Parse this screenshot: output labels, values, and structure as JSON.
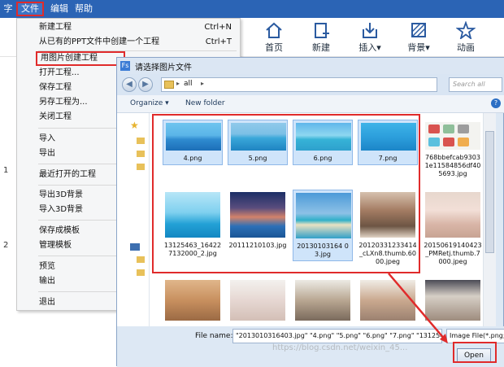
{
  "menubar": {
    "app_icon": "字",
    "items": [
      "文件",
      "编辑",
      "帮助"
    ]
  },
  "ribbon": {
    "buttons": [
      {
        "label": "首页",
        "icon": "home-icon"
      },
      {
        "label": "新建",
        "icon": "new-file-icon"
      },
      {
        "label": "插入▾",
        "icon": "insert-icon"
      },
      {
        "label": "背景▾",
        "icon": "background-icon"
      },
      {
        "label": "动画",
        "icon": "animation-star-icon"
      }
    ]
  },
  "left_numbers": [
    "1",
    "2"
  ],
  "file_menu": {
    "items": [
      {
        "label": "新建工程",
        "shortcut": "Ctrl+N"
      },
      {
        "label": "从已有的PPT文件中创建一个工程",
        "shortcut": "Ctrl+T"
      },
      {
        "label": "用图片创建工程",
        "shortcut": "",
        "highlighted": true
      },
      {
        "label": "打开工程...",
        "shortcut": ""
      },
      {
        "label": "保存工程",
        "shortcut": ""
      },
      {
        "label": "另存工程为...",
        "shortcut": ""
      },
      {
        "label": "关闭工程",
        "shortcut": ""
      },
      {
        "label": "导入",
        "shortcut": ""
      },
      {
        "label": "导出",
        "shortcut": ""
      },
      {
        "label": "最近打开的工程",
        "shortcut": ""
      },
      {
        "label": "导出3D背景",
        "shortcut": ""
      },
      {
        "label": "导入3D背景",
        "shortcut": ""
      },
      {
        "label": "保存成模板",
        "shortcut": ""
      },
      {
        "label": "管理模板",
        "shortcut": ""
      },
      {
        "label": "预览",
        "shortcut": ""
      },
      {
        "label": "输出",
        "shortcut": ""
      },
      {
        "label": "退出",
        "shortcut": ""
      }
    ]
  },
  "dialog": {
    "title": "请选择图片文件",
    "title_icon": "Fs",
    "path": "all",
    "search_placeholder": "Search all",
    "toolbar": {
      "organize": "Organize ▾",
      "new_folder": "New folder",
      "help": "?"
    },
    "files": [
      {
        "name": "4.png",
        "selected": true,
        "thumb": "pier"
      },
      {
        "name": "5.png",
        "selected": true,
        "thumb": "resort"
      },
      {
        "name": "6.png",
        "selected": true,
        "thumb": "beach"
      },
      {
        "name": "7.png",
        "selected": true,
        "thumb": "under"
      },
      {
        "name": "768bbefcab93031e11584856df405693.jpg",
        "selected": false,
        "thumb": "icons"
      },
      {
        "name": "13125463_164227132000_2.jpg",
        "selected": false,
        "thumb": "wave"
      },
      {
        "name": "20111210103.jpg",
        "selected": false,
        "thumb": "pool"
      },
      {
        "name": "20130103164 03.jpg",
        "selected": true,
        "thumb": "island"
      },
      {
        "name": "20120331233414_cLXn8.thumb.6000.jpeg",
        "selected": false,
        "thumb": "girl"
      },
      {
        "name": "20150619140423_PMRetj.thumb.7000.jpeg",
        "selected": false,
        "thumb": "girl2"
      }
    ],
    "bottom_row_thumbs": [
      "girl3",
      "girl4",
      "girl5",
      "girl6",
      "girl7"
    ],
    "file_name_label": "File name:",
    "file_name_value": "\"2013010316403.jpg\" \"4.png\" \"5.png\" \"6.png\" \"7.png\" \"131254",
    "file_type": "Image File(*.png;*",
    "open_button": "Open"
  },
  "watermark": "https://blog.csdn.net/weixin_45..."
}
